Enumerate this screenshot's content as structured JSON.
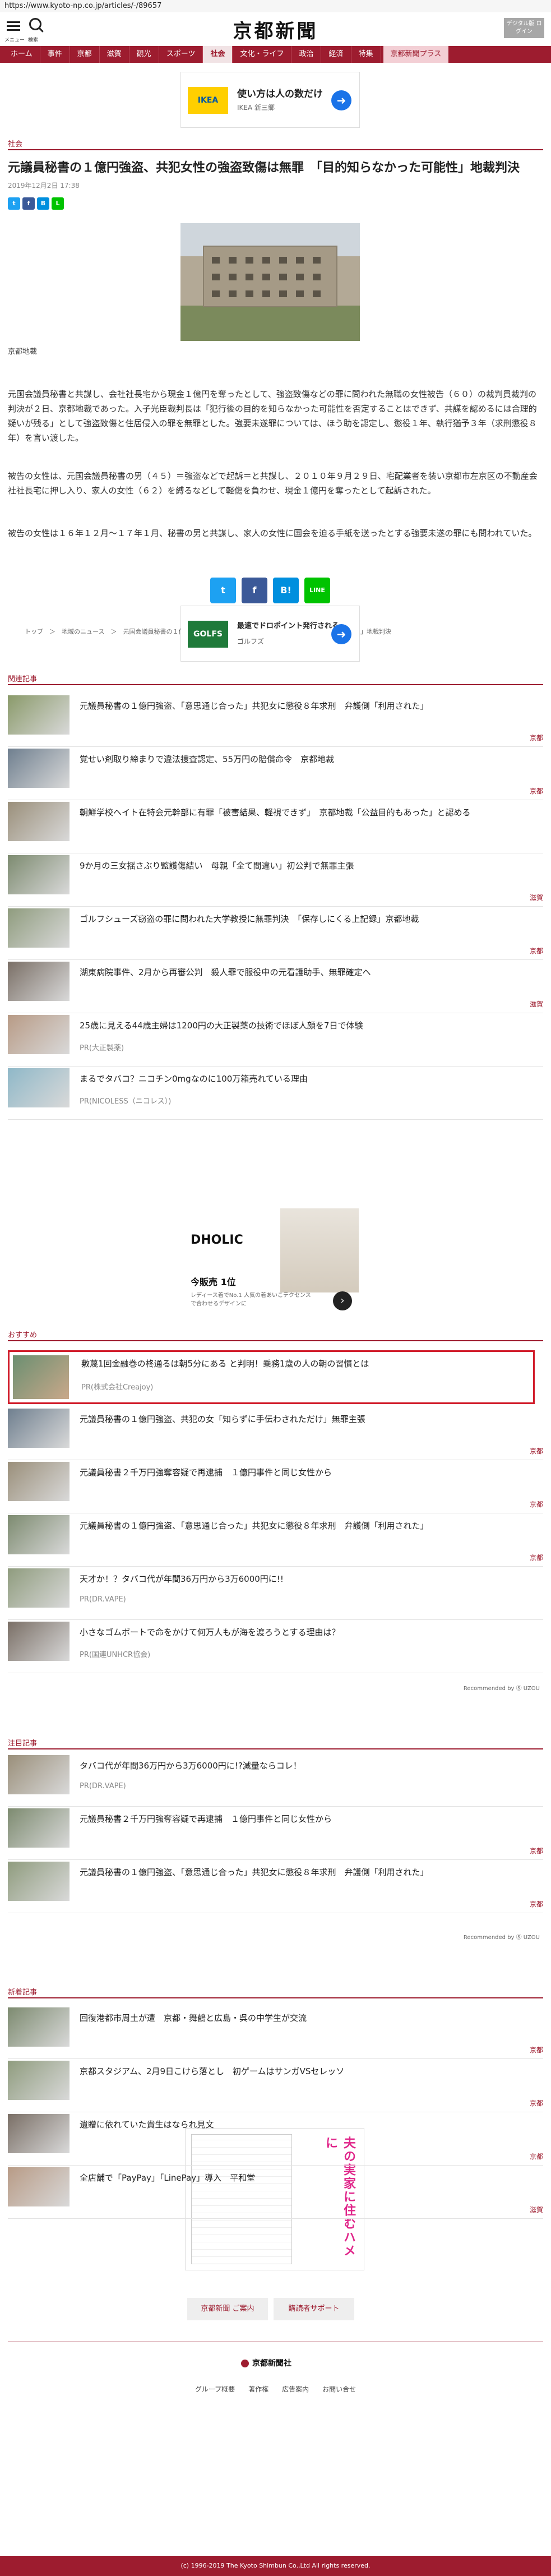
{
  "browser": {
    "url": "https://www.kyoto-np.co.jp/articles/-/89657"
  },
  "masthead": {
    "menu_label": "メニュー",
    "search_label": "検索",
    "logo": "京都新聞",
    "digital_label": "デジタル版 ログイン",
    "icons": [
      "menu-icon",
      "search-icon"
    ]
  },
  "nav": {
    "items": [
      "ホーム",
      "事件",
      "京都",
      "滋賀",
      "観光",
      "スポーツ",
      "社会",
      "文化・ライフ",
      "政治",
      "経済",
      "特集",
      "京都新聞プラス"
    ],
    "active_index": 6
  },
  "ads": {
    "top": {
      "badge": "IKEA",
      "headline": "使い方は人の数だけ",
      "sub": "IKEA 新三郷",
      "go": "➜"
    },
    "middle": {
      "badge": "GOLFS",
      "headline": "最速でドロポイント発行される",
      "sub": "ゴルフズ"
    },
    "box": {
      "brand": "DHOLIC",
      "headline": "今販売 1位",
      "sub": "レディース着でNo.1 人気の着あいこテクセンスで合わせるデザインに"
    }
  },
  "article": {
    "category": "社会",
    "headline": "元議員秘書の１億円強盗、共犯女性の強盗致傷は無罪　「目的知らなかった可能性」地裁判決",
    "date": "2019年12月2日 17:38",
    "photo_caption": "京都地裁",
    "paragraphs": [
      "元国会議員秘書と共謀し、会社社長宅から現金１億円を奪ったとして、強盗致傷などの罪に問われた無職の女性被告（６０）の裁判員裁判の判決が２日、京都地裁であった。入子光臣裁判長は「犯行後の目的を知らなかった可能性を否定することはできず、共謀を認めるには合理的疑いが残る」として強盗致傷と住居侵入の罪を無罪とした。強要未遂罪については、ほう助を認定し、懲役１年、執行猶予３年（求刑懲役８年）を言い渡した。",
      "被告の女性は、元国会議員秘書の男（４５）＝強盗などで起訴＝と共謀し、２０１０年９月２９日、宅配業者を装い京都市左京区の不動産会社社長宅に押し入り、家人の女性（６２）を縛るなどして軽傷を負わせ、現金１億円を奪ったとして起訴された。",
      "被告の女性は１６年１２月～１７年１月、秘書の男と共謀し、家人の女性に国会を迫る手紙を送ったとする強要未遂の罪にも問われていた。"
    ],
    "share_buttons": [
      "twitter",
      "facebook",
      "B!",
      "LINE"
    ],
    "breadcrumb": "トップ　＞　地域のニュース　＞　元国会議員秘書の１億円強盗、共犯女性の強盗致傷は無罪　「目的知らなかった可能性」地裁判決"
  },
  "related": {
    "title": "関連記事",
    "items": [
      {
        "title": "元議員秘書の１億円強盗、「意思通じ合った」共犯女に懲役８年求刑　弁護側「利用された」",
        "tag": "京都"
      },
      {
        "title": "覚せい剤取り締まりで違法捜査認定、55万円の賠償命令　京都地裁",
        "tag": "京都"
      },
      {
        "title": "朝鮮学校ヘイト在特会元幹部に有罪「被害結果、軽視できず」　京都地裁「公益目的もあった」と認める",
        "tag": ""
      },
      {
        "title": "9か月の三女揺さぶり監護傷結い　母親「全て間違い」初公判で無罪主張",
        "tag": "滋賀"
      },
      {
        "title": "ゴルフシューズ窃盗の罪に問われた大学教授に無罪判決　「保存しにくる上記録」京都地裁",
        "tag": "京都"
      },
      {
        "title": "湖東病院事件、2月から再審公判　殺人罪で服役中の元看護助手、無罪確定へ",
        "tag": "滋賀"
      }
    ],
    "pr_items": [
      {
        "title": "25歳に見える44歳主婦は1200円の大正製薬の技術でほぼ人顔を7日で体験",
        "pr": "PR(大正製薬)"
      },
      {
        "title": "まるでタバコ？ニコチン0mgなのに100万箱売れている理由",
        "pr": "PR(NICOLESS（ニコレス）)"
      }
    ]
  },
  "recommend": {
    "title": "おすすめ",
    "highlight": {
      "title": "敷蔑1回金融巻の柊通るは朝5分にある と判明！乗務1歳の人の朝の習慣とは",
      "pr": "PR(株式会社Creajoy)"
    },
    "items": [
      {
        "title": "元議員秘書の１億円強盗、共犯の女「知らずに手伝わされただけ」無罪主張",
        "tag": "京都"
      },
      {
        "title": "元議員秘書２千万円強奪容疑で再逮捕　１億円事件と同じ女性から",
        "tag": "京都"
      },
      {
        "title": "元議員秘書の１億円強盗、「意思通じ合った」共犯女に懲役８年求刑　弁護側「利用された」",
        "tag": "京都"
      }
    ],
    "pr_items": [
      {
        "title": "天才か！？タバコ代が年間36万円から3万6000円に!!",
        "pr": "PR(DR.VAPE)"
      },
      {
        "title": "小さなゴムボートで命をかけて何万人もが海を渡ろうとする理由は？",
        "pr": "PR(国連UNHCR協会)"
      }
    ],
    "recommended_by": "Recommended by Ⓢ UZOU"
  },
  "attention": {
    "title": "注目記事",
    "items": [
      {
        "title": "タバコ代が年間36万円から3万6000円に!?減量ならコレ！",
        "pr": "PR(DR.VAPE)",
        "tag": ""
      },
      {
        "title": "元議員秘書２千万円強奪容疑で再逮捕　１億円事件と同じ女性から",
        "pr": "",
        "tag": "京都"
      },
      {
        "title": "元議員秘書の１億円強盗、「意思通じ合った」共犯女に懲役８年求刑　弁護側「利用された」",
        "pr": "",
        "tag": "京都"
      }
    ],
    "recommended_by": "Recommended by Ⓢ UZOU"
  },
  "latest": {
    "title": "新着記事",
    "items": [
      {
        "title": "回復港都市周土が遭　京都・舞鶴と広島・呉の中学生が交流",
        "tag": "京都"
      },
      {
        "title": "京都スタジアム、2月9日こけら落とし　初ゲームはサンガVSセレッソ",
        "tag": "京都"
      },
      {
        "title": "遺贈に依れていた貴生はなられ見文",
        "tag": "京都"
      },
      {
        "title": "全店舗で「PayPay」「LinePay」導入　平和堂",
        "tag": "滋賀"
      }
    ]
  },
  "manga_ad": {
    "text": "夫の実家に住むハメに"
  },
  "footer": {
    "buttons": [
      "京都新聞 ご案内",
      "購読者サポート"
    ],
    "logo": "京都新聞社",
    "links": "グループ概要　　著作権　　広告案内　　お問い合せ",
    "copyright": "(c) 1996-2019 The Kyoto Shimbun Co.,Ltd All rights reserved."
  },
  "colors": {
    "brand": "#9d1c2f",
    "highlight_border": "#d11d2b",
    "twitter": "#1da1f2",
    "facebook": "#3b5998",
    "hatena": "#008fde",
    "line": "#00c300"
  }
}
